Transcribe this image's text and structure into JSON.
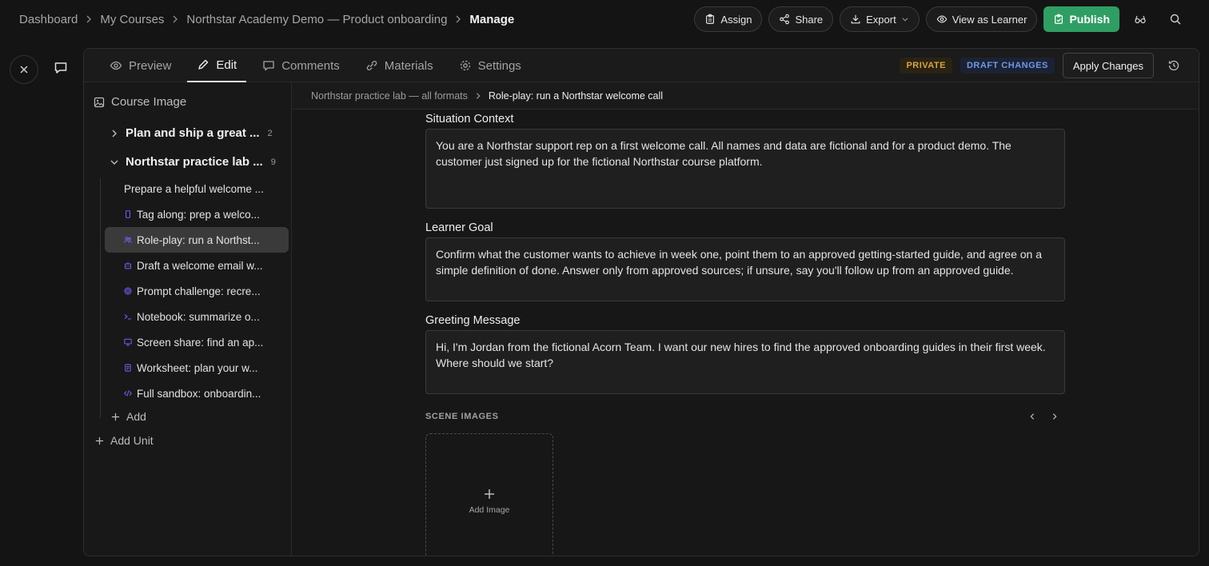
{
  "breadcrumb": {
    "items": [
      "Dashboard",
      "My Courses",
      "Northstar Academy Demo — Product onboarding"
    ],
    "current": "Manage"
  },
  "actions": {
    "assign": "Assign",
    "share": "Share",
    "export": "Export",
    "view_as_learner": "View as Learner",
    "publish": "Publish"
  },
  "tabs": [
    "Preview",
    "Edit",
    "Comments",
    "Materials",
    "Settings"
  ],
  "status": {
    "private": "PRIVATE",
    "draft": "DRAFT CHANGES",
    "apply": "Apply Changes"
  },
  "sidebar": {
    "course_image": "Course Image",
    "units": [
      {
        "title": "Plan and ship a great ...",
        "count": "2"
      },
      {
        "title": "Northstar practice lab ...",
        "count": "9"
      }
    ],
    "lessons": [
      {
        "title": "Prepare a helpful welcome ...",
        "icon": "none"
      },
      {
        "title": "Tag along: prep a welco...",
        "icon": "phone-icon",
        "color": "#7b5cff"
      },
      {
        "title": "Role-play: run a Northst...",
        "icon": "people-icon",
        "color": "#7b5cff"
      },
      {
        "title": "Draft a welcome email w...",
        "icon": "robot-icon",
        "color": "#7b5cff"
      },
      {
        "title": "Prompt challenge: recre...",
        "icon": "target-icon",
        "color": "#7b5cff"
      },
      {
        "title": "Notebook: summarize o...",
        "icon": "terminal-icon",
        "color": "#7b5cff"
      },
      {
        "title": "Screen share: find an ap...",
        "icon": "screen-icon",
        "color": "#7b5cff"
      },
      {
        "title": "Worksheet: plan your w...",
        "icon": "worksheet-icon",
        "color": "#7b5cff"
      },
      {
        "title": "Full sandbox: onboardin...",
        "icon": "code-icon",
        "color": "#7b5cff"
      }
    ],
    "add": "Add",
    "add_unit": "Add Unit"
  },
  "content": {
    "subcrumb": [
      "Northstar practice lab — all formats"
    ],
    "subcrumb_current": "Role-play: run a Northstar welcome call",
    "situation_label": "Situation Context",
    "situation_text": "You are a Northstar support rep on a first welcome call. All names and data are fictional and for a product demo. The customer just signed up for the fictional Northstar course platform.",
    "goal_label": "Learner Goal",
    "goal_text": "Confirm what the customer wants to achieve in week one, point them to an approved getting-started guide, and agree on a simple definition of done. Answer only from approved sources; if unsure, say you'll follow up from an approved guide.",
    "greeting_label": "Greeting Message",
    "greeting_text": "Hi, I'm Jordan from the fictional Acorn Team. I want our new hires to find the approved onboarding guides in their first week. Where should we start?",
    "scene_images": "SCENE IMAGES",
    "add_image": "Add Image"
  }
}
